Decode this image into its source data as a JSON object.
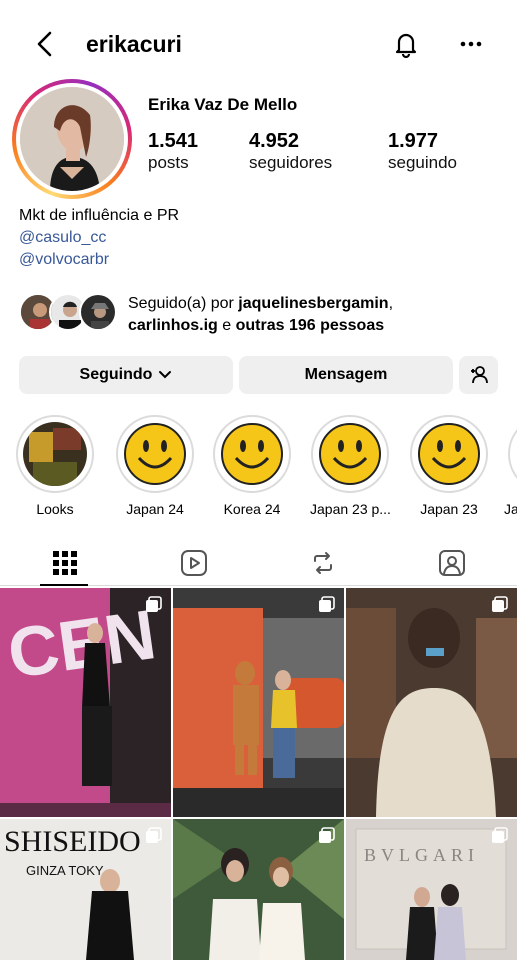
{
  "header": {
    "username": "erikacuri",
    "back_icon": "chevron-left-icon",
    "notification_icon": "bell-icon",
    "more_icon": "more-horizontal-icon"
  },
  "profile": {
    "full_name": "Erika Vaz De Mello",
    "stats": [
      {
        "value": "1.541",
        "label": "posts"
      },
      {
        "value": "4.952",
        "label": "seguidores"
      },
      {
        "value": "1.977",
        "label": "seguindo"
      }
    ],
    "bio": {
      "line1": "Mkt de influência e PR",
      "link1": "@casulo_cc",
      "link2": "@volvocarbr"
    },
    "followed_by": {
      "prefix": "Seguido(a) por ",
      "user1": "jaquelinesbergamin",
      "comma": ",",
      "user2": "carlinhos.ig",
      "middle": " e ",
      "others": "outras 196 pessoas"
    }
  },
  "actions": {
    "following_label": "Seguindo",
    "message_label": "Mensagem",
    "add_friend_icon": "add-user-icon"
  },
  "highlights": [
    {
      "label": "Looks"
    },
    {
      "label": "Japan 24"
    },
    {
      "label": "Korea 24"
    },
    {
      "label": "Japan 23 p..."
    },
    {
      "label": "Japan 23"
    },
    {
      "label": "Ja"
    }
  ],
  "tabs": [
    {
      "name": "grid",
      "icon": "grid-icon"
    },
    {
      "name": "reels",
      "icon": "reels-icon"
    },
    {
      "name": "reposts",
      "icon": "repost-icon"
    },
    {
      "name": "tagged",
      "icon": "tagged-user-icon"
    }
  ],
  "posts": [
    {
      "overlay_text": "CEN"
    },
    {
      "overlay_text": ""
    },
    {
      "overlay_text": ""
    },
    {
      "overlay_text": "SHISEIDO",
      "overlay_sub": "GINZA TOKY"
    },
    {
      "overlay_text": ""
    },
    {
      "overlay_text": "BVLGARI"
    }
  ],
  "colors": {
    "link": "#385898",
    "button_bg": "#efefef",
    "smiley": "#f5c518"
  }
}
